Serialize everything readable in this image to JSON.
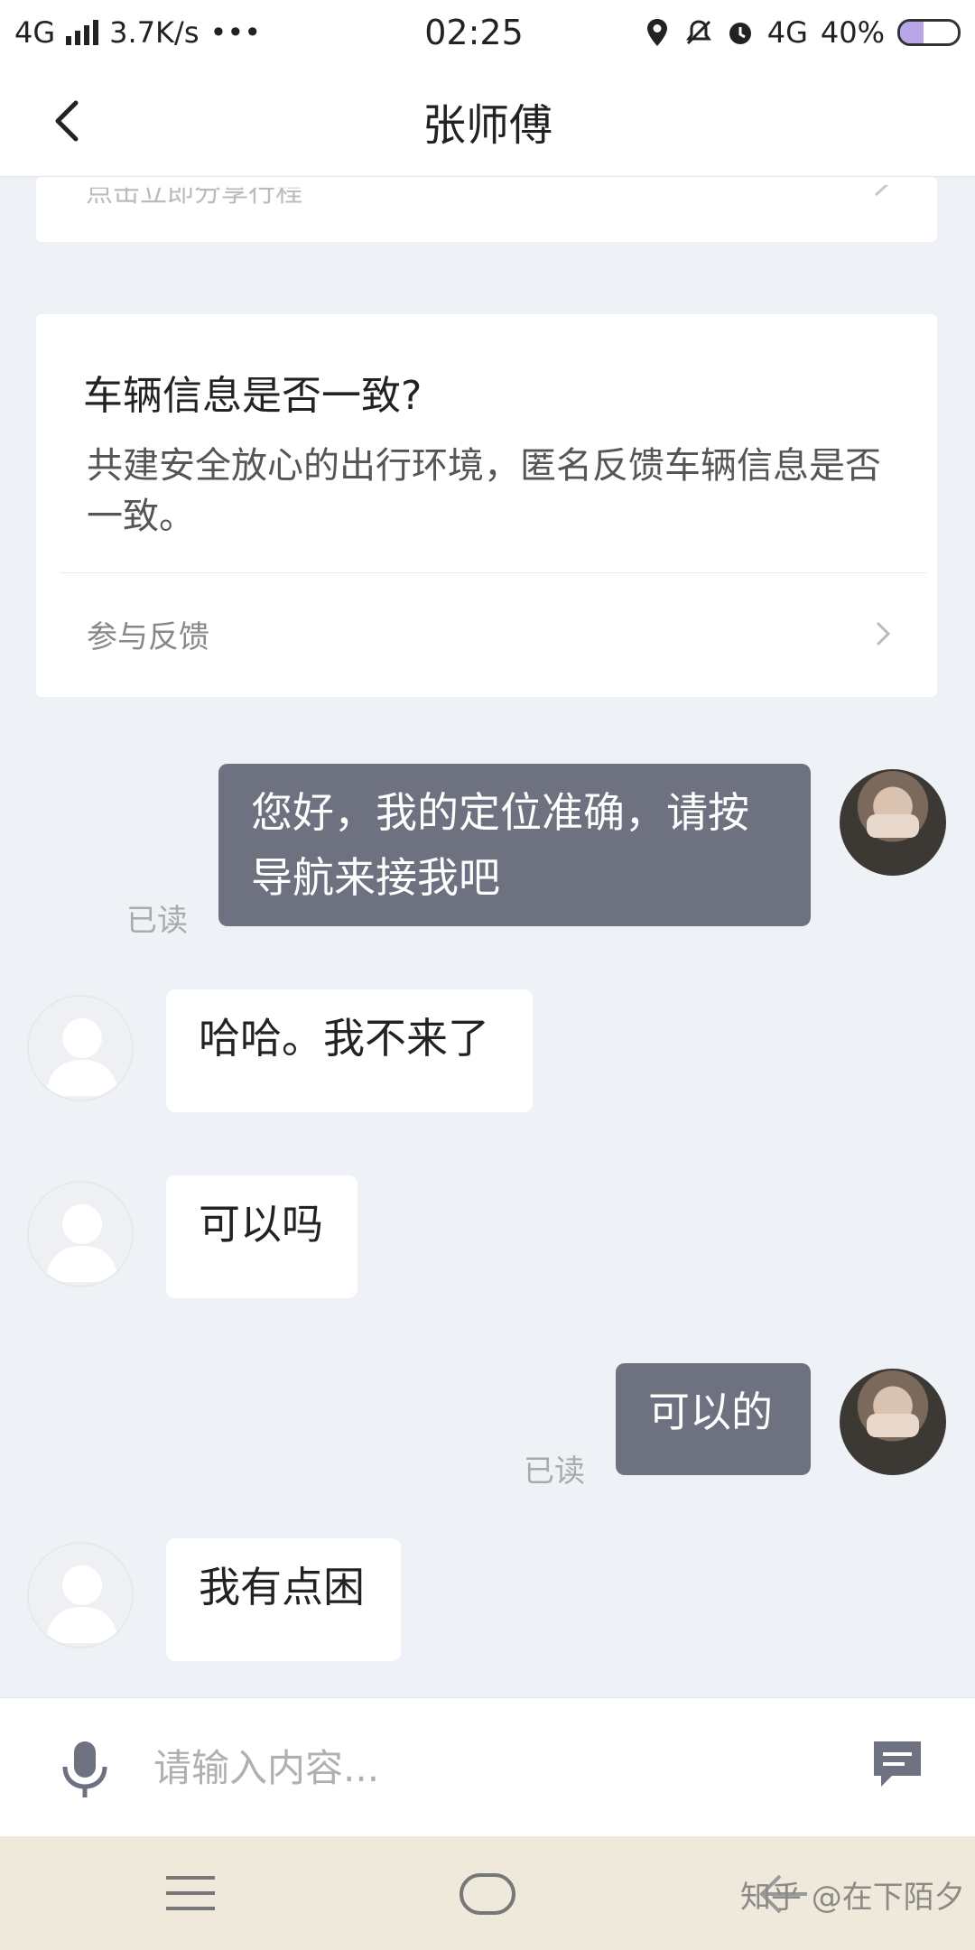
{
  "status_bar": {
    "network": "4G",
    "speed": "3.7K/s",
    "dots": "•••",
    "time": "02:25",
    "network_right": "4G",
    "battery_text": "40%",
    "battery_level": 0.4
  },
  "header": {
    "title": "张师傅"
  },
  "top_card": {
    "faded_text": "点击立即分享行程"
  },
  "feedback_card": {
    "title": "车辆信息是否一致?",
    "description": "共建安全放心的出行环境，匿名反馈车辆信息是否一致。",
    "link_label": "参与反馈"
  },
  "messages": [
    {
      "from": "me",
      "text": "您好，我的定位准确，请按导航来接我吧",
      "status": "已读"
    },
    {
      "from": "other",
      "text": "哈哈。我不来了"
    },
    {
      "from": "other",
      "text": "可以吗"
    },
    {
      "from": "me",
      "text": "可以的",
      "status": "已读"
    },
    {
      "from": "other",
      "text": "我有点困"
    }
  ],
  "input": {
    "placeholder": "请输入内容..."
  },
  "watermark": "知乎 @在下陌夕",
  "colors": {
    "background": "#eef2f7",
    "my_bubble": "#6e7280",
    "other_bubble": "#ffffff",
    "nav_bar": "#efe9dc"
  }
}
